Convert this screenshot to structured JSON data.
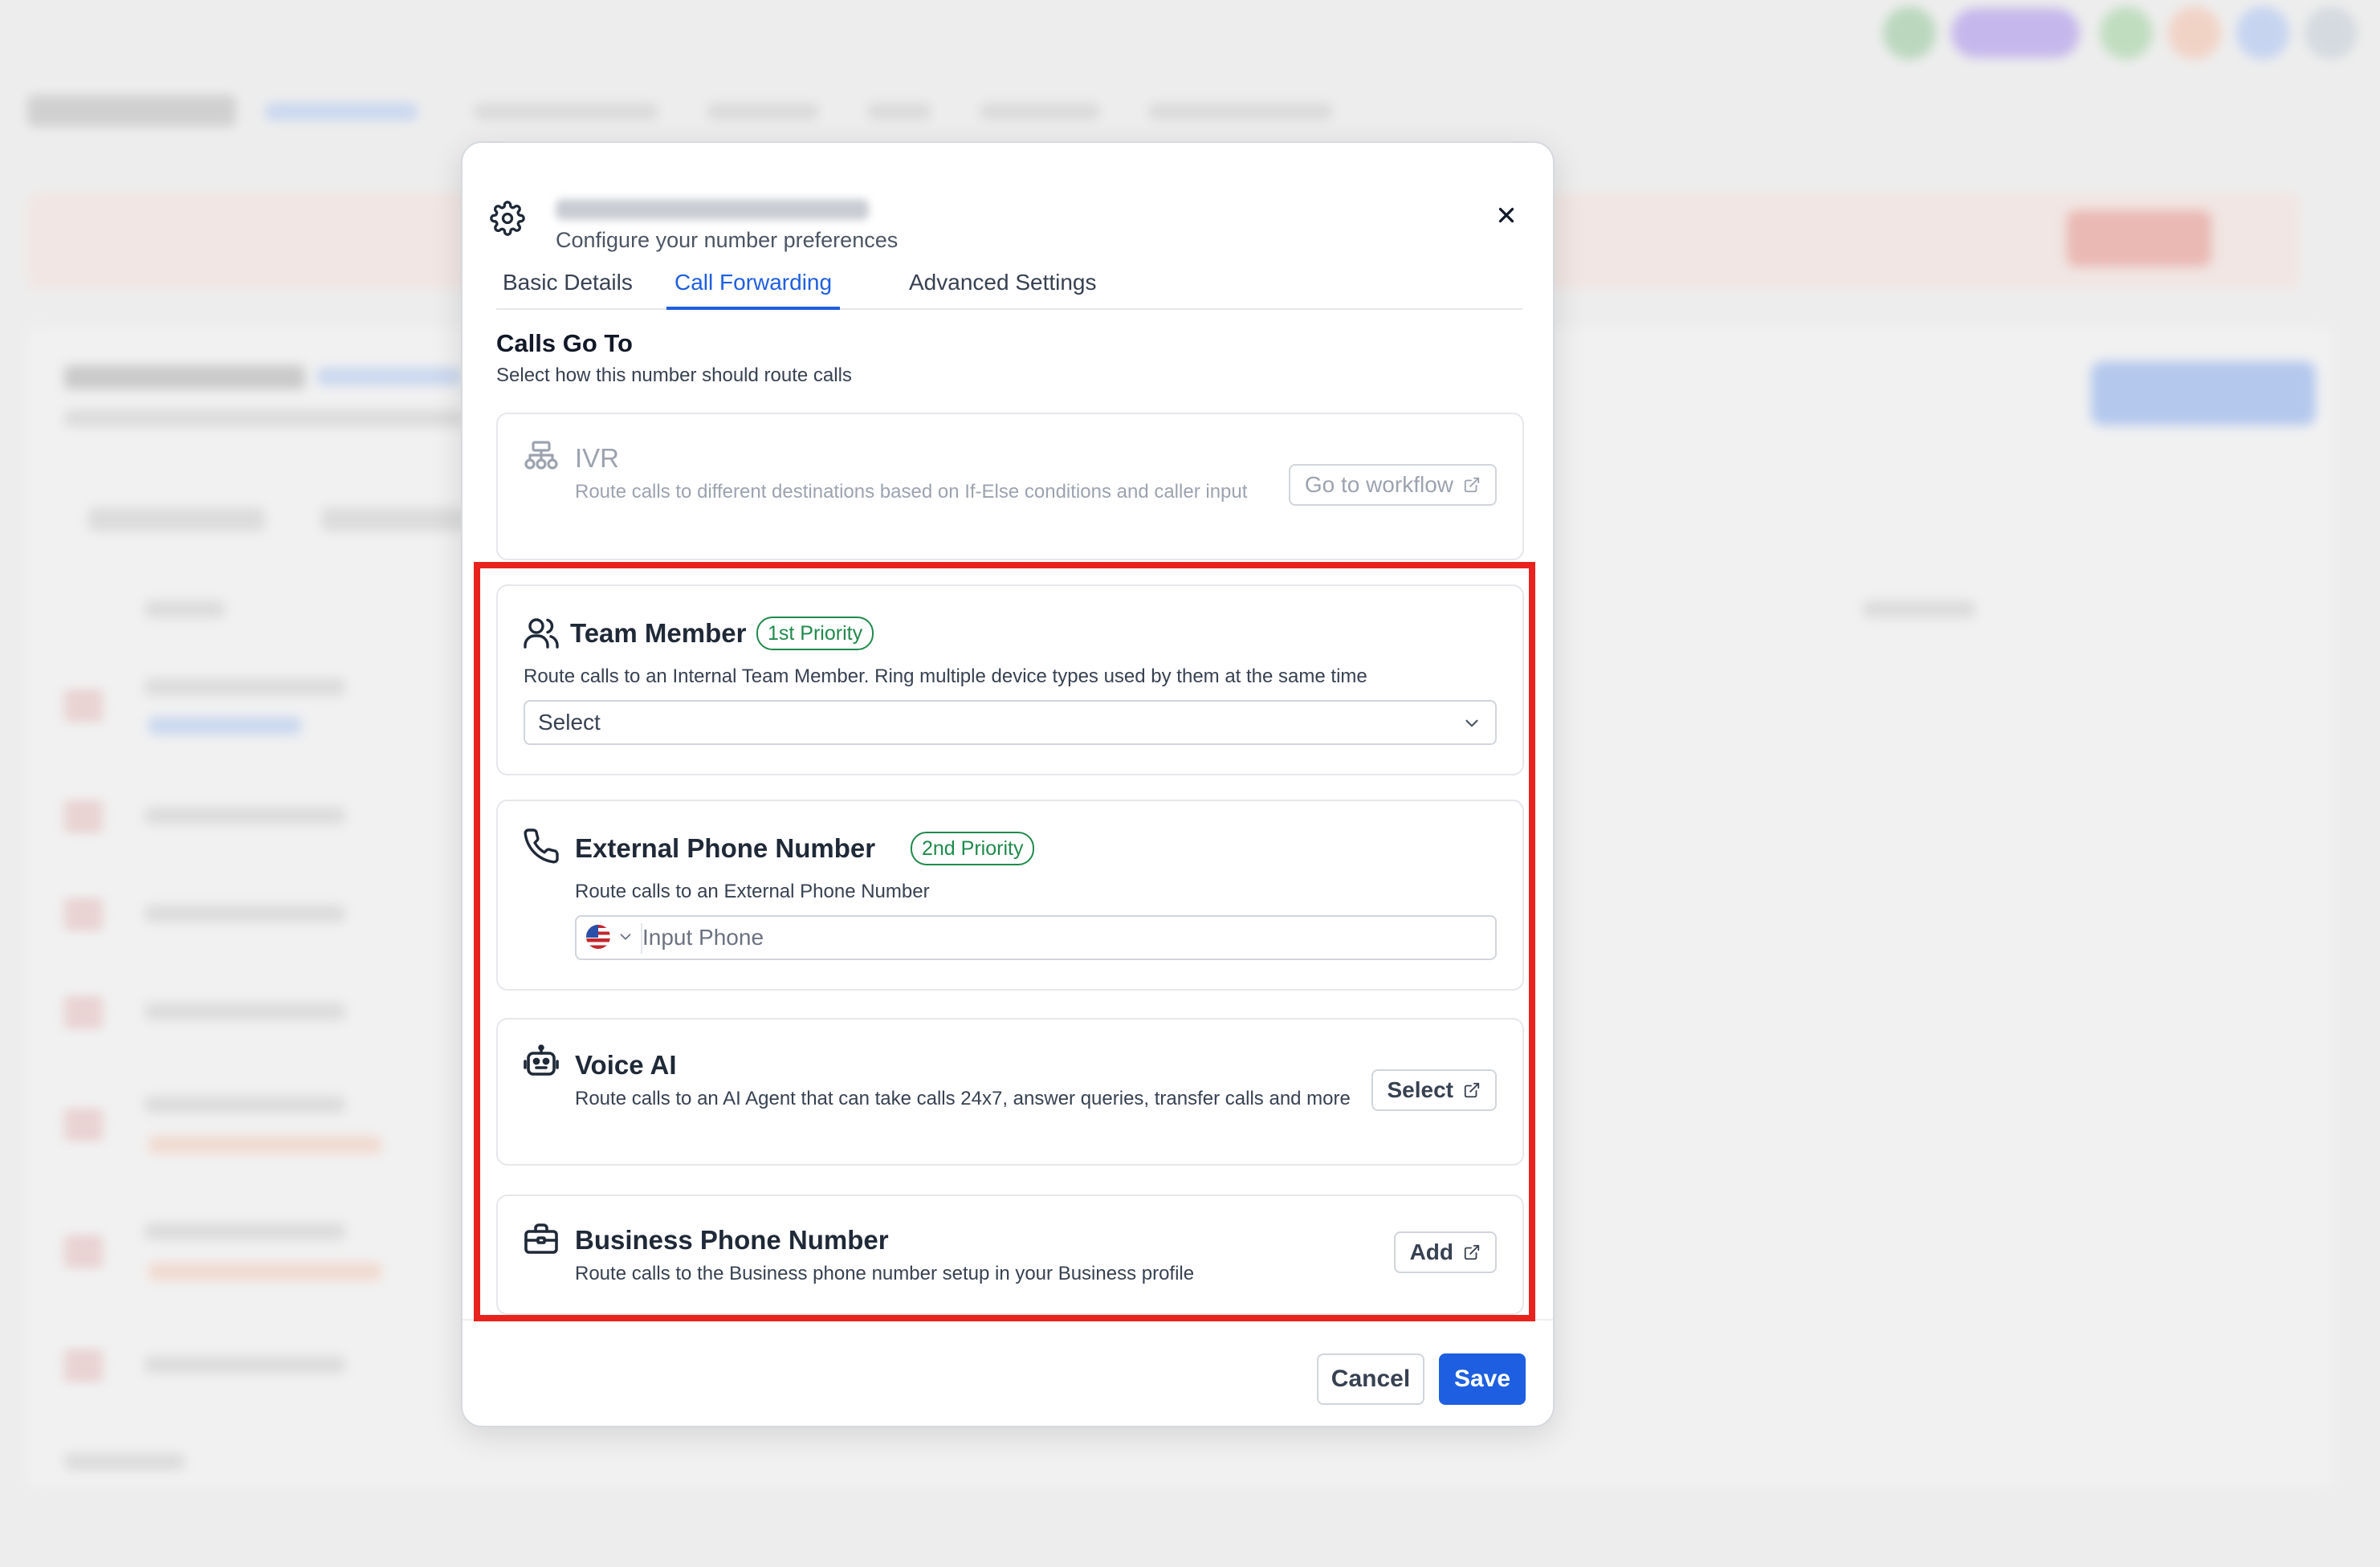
{
  "modal": {
    "subtitle": "Configure your number preferences",
    "tabs": [
      {
        "label": "Basic Details"
      },
      {
        "label": "Call Forwarding"
      },
      {
        "label": "Advanced Settings"
      }
    ],
    "active_tab": "Call Forwarding",
    "section": {
      "title": "Calls Go To",
      "description": "Select how this number should route calls"
    },
    "options": {
      "ivr": {
        "title": "IVR",
        "description": "Route calls to different destinations based on If-Else conditions and caller input",
        "button": "Go to workflow",
        "icon": "workflow-icon",
        "disabled": true
      },
      "team_member": {
        "title": "Team Member",
        "badge": "1st Priority",
        "description": "Route calls to an Internal Team Member. Ring multiple device types used by them at the same time",
        "select_value": "Select",
        "icon": "users-icon"
      },
      "external_phone": {
        "title": "External Phone Number",
        "badge": "2nd Priority",
        "description": "Route calls to an External Phone Number",
        "placeholder": "Input Phone",
        "icon": "phone-icon"
      },
      "voice_ai": {
        "title": "Voice AI",
        "description": "Route calls to an AI Agent that can take calls 24x7, answer queries, transfer calls and more",
        "button": "Select",
        "icon": "robot-icon"
      },
      "business_phone": {
        "title": "Business Phone Number",
        "description": "Route calls to the Business phone number setup in your Business profile",
        "button": "Add",
        "icon": "briefcase-icon"
      }
    },
    "footer": {
      "cancel_label": "Cancel",
      "save_label": "Save"
    }
  },
  "colors": {
    "accent": "#1d5fe0",
    "priority_badge": "#1f8a4c",
    "highlight_box": "#e8231d"
  }
}
